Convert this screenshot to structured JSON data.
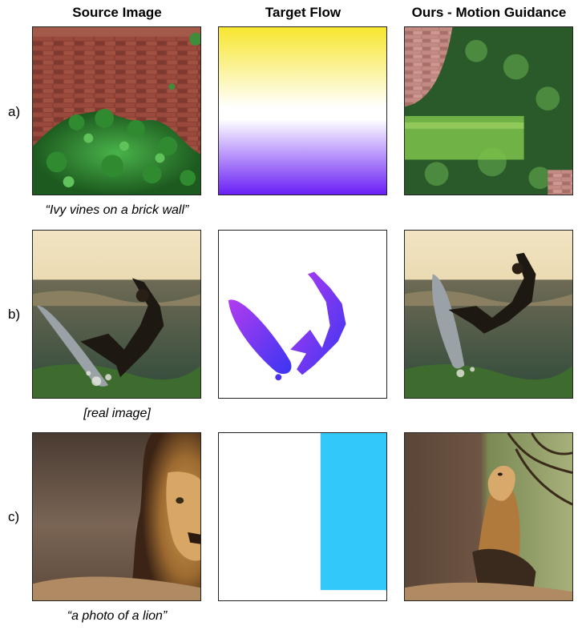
{
  "columns": {
    "source": "Source Image",
    "target": "Target Flow",
    "ours": "Ours - Motion Guidance"
  },
  "rows": [
    {
      "label": "a)",
      "caption": "“Ivy vines on a brick wall”"
    },
    {
      "label": "b)",
      "caption": "[real image]"
    },
    {
      "label": "c)",
      "caption": "“a photo of a lion”"
    }
  ],
  "colors": {
    "flow_yellow": "#f7e62e",
    "flow_purple": "#6a1ff5",
    "flow_magenta": "#b23cf0",
    "flow_blue": "#4a32f2",
    "flow_cyan": "#33c8fa"
  }
}
